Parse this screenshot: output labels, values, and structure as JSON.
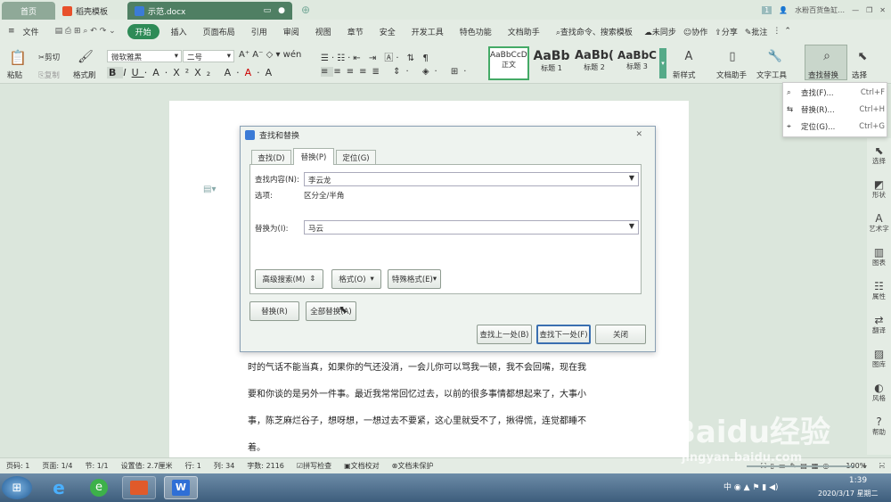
{
  "titlebar": {
    "tabs": [
      {
        "label": "首页"
      },
      {
        "label": "稻壳模板"
      },
      {
        "label": "示范.docx"
      }
    ],
    "user_label": "水粉百货鱼缸…",
    "badge": "1"
  },
  "menu": {
    "file": "文件",
    "items": [
      "开始",
      "插入",
      "页面布局",
      "引用",
      "审阅",
      "视图",
      "章节",
      "安全",
      "开发工具",
      "特色功能",
      "文档助手"
    ],
    "search": "查找命令、搜索模板",
    "sync": "未同步",
    "collab": "协作",
    "share": "分享",
    "comment": "批注"
  },
  "ribbon": {
    "paste": "粘贴",
    "cut": "剪切",
    "copy": "复制",
    "format_painter": "格式刷",
    "font_name": "微软雅黑",
    "font_size": "二号",
    "styles": [
      {
        "sample": "AaBbCcDd",
        "name": "正文"
      },
      {
        "sample": "AaBb",
        "name": "标题 1"
      },
      {
        "sample": "AaBb(",
        "name": "标题 2"
      },
      {
        "sample": "AaBbC",
        "name": "标题 3"
      }
    ],
    "new_style": "新样式",
    "doc_helper": "文档助手",
    "text_tools": "文字工具",
    "find_replace": "查找替换",
    "select": "选择"
  },
  "find_menu": {
    "items": [
      {
        "label": "查找(F)...",
        "key": "Ctrl+F"
      },
      {
        "label": "替换(R)...",
        "key": "Ctrl+H"
      },
      {
        "label": "定位(G)...",
        "key": "Ctrl+G"
      }
    ]
  },
  "sidebar": {
    "items": [
      "选择",
      "形状",
      "艺术字",
      "图表",
      "属性",
      "翻译",
      "图库",
      "风格",
      "帮助"
    ]
  },
  "dialog": {
    "title": "查找和替换",
    "tabs": [
      "查找(D)",
      "替换(P)",
      "定位(G)"
    ],
    "find_label": "查找内容(N):",
    "find_value": "李云龙",
    "options_label": "选项:",
    "options_value": "区分全/半角",
    "replace_label": "替换为(I):",
    "replace_value": "马云",
    "advanced": "高级搜索(M)",
    "format": "格式(O)",
    "special": "特殊格式(E)",
    "replace_btn": "替换(R)",
    "replace_all": "全部替换(A)",
    "find_prev": "查找上一处(B)",
    "find_next": "查找下一处(F)",
    "close": "关闭"
  },
  "document": {
    "lines": [
      "时的气话不能当真，如果你的气还没消，一会儿你可以骂我一顿，我不会回嘴，现在我",
      "要和你谈的是另外一件事。最近我常常回忆过去，以前的很多事情都想起来了，大事小",
      "事，陈芝麻烂谷子，想呀想，一想过去不要紧，这心里就受不了，揪得慌，连觉都睡不",
      "着。"
    ]
  },
  "status": {
    "page_num": "页码: 1",
    "pages": "页面: 1/4",
    "section": "节: 1/1",
    "setting": "设置值: 2.7厘米",
    "row": "行: 1",
    "col": "列: 34",
    "words": "字数: 2116",
    "spell": "拼写检查",
    "proof": "文档校对",
    "protect": "文档未保护",
    "zoom": "100%"
  },
  "taskbar": {
    "time": "1:39",
    "date": "2020/3/17 星期二",
    "ime": "中"
  },
  "watermark": {
    "brand": "Baidu经验",
    "url": "jingyan.baidu.com"
  }
}
